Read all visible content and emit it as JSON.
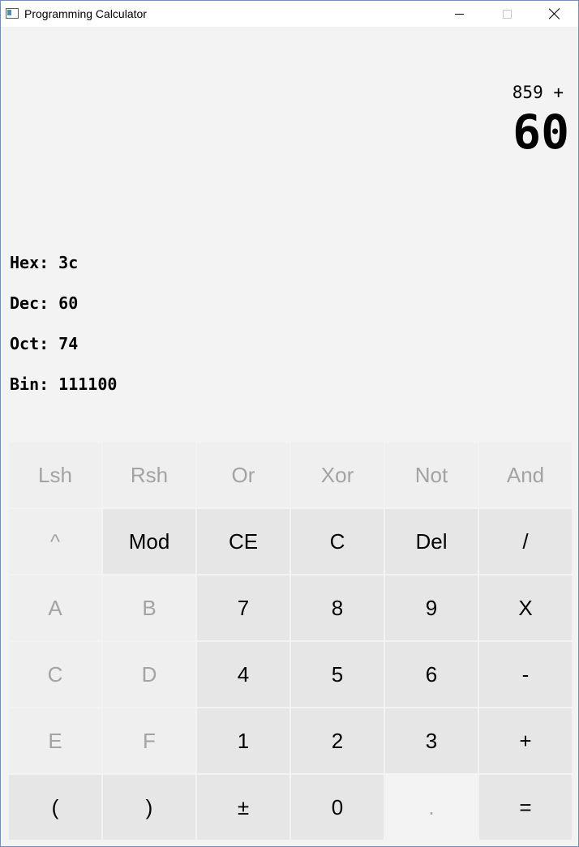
{
  "window": {
    "title": "Programming Calculator"
  },
  "display": {
    "expression": "859 +",
    "result": "60",
    "conversions": [
      {
        "label": "Hex:",
        "value": "3c"
      },
      {
        "label": "Dec:",
        "value": "60"
      },
      {
        "label": "Oct:",
        "value": "74"
      },
      {
        "label": "Bin:",
        "value": "111100"
      }
    ]
  },
  "keys": [
    [
      "Lsh",
      "Rsh",
      "Or",
      "Xor",
      "Not",
      "And"
    ],
    [
      "^",
      "Mod",
      "CE",
      "C",
      "Del",
      "/"
    ],
    [
      "A",
      "B",
      "7",
      "8",
      "9",
      "X"
    ],
    [
      "C",
      "D",
      "4",
      "5",
      "6",
      "-"
    ],
    [
      "E",
      "F",
      "1",
      "2",
      "3",
      "+"
    ],
    [
      "(",
      ")",
      "±",
      "0",
      ".",
      "="
    ]
  ]
}
